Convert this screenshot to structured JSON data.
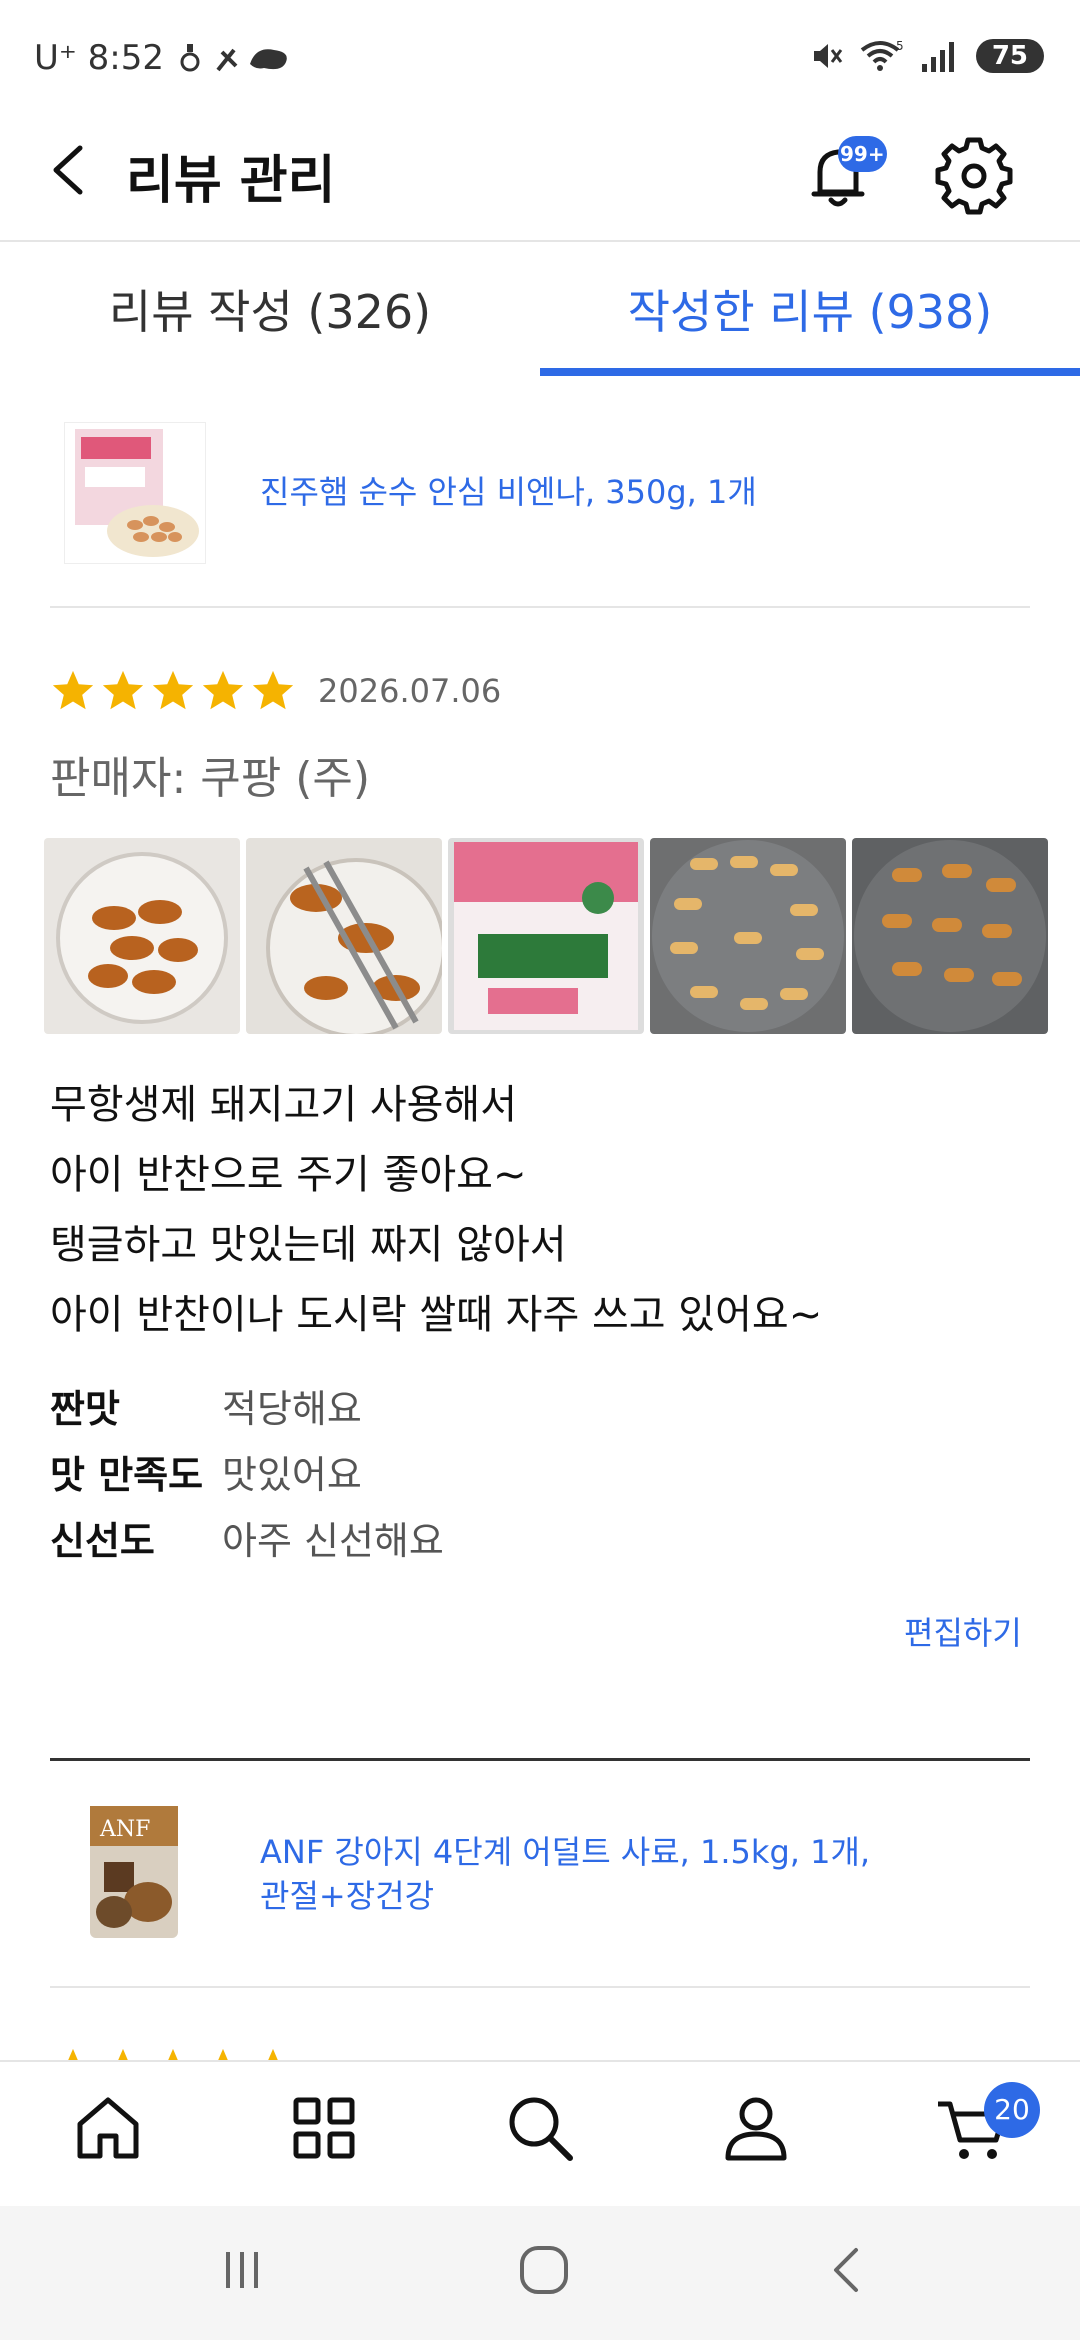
{
  "status_bar": {
    "carrier_time": "U⁺ 8:52",
    "battery": "75"
  },
  "header": {
    "title": "리뷰 관리",
    "notification_badge": "99+"
  },
  "tabs": [
    {
      "label": "리뷰 작성  (326)",
      "active": false
    },
    {
      "label": "작성한 리뷰 (938)",
      "active": true
    }
  ],
  "review": {
    "product_name": "진주햄 순수 안심 비엔나, 350g, 1개",
    "rating": 5,
    "date": "2026.07.06",
    "seller": "판매자: 쿠팡 (주)",
    "photo_count": 5,
    "text_lines": [
      "무항생제 돼지고기 사용해서",
      "아이 반찬으로 주기 좋아요~",
      "탱글하고 맛있는데 짜지 않아서",
      "아이 반찬이나 도시락 쌀때 자주 쓰고 있어요~"
    ],
    "ratings": [
      {
        "label": "짠맛",
        "value": "적당해요"
      },
      {
        "label": "맛 만족도",
        "value": "맛있어요"
      },
      {
        "label": "신선도",
        "value": "아주 신선해요"
      }
    ],
    "edit_label": "편집하기"
  },
  "next_product": {
    "name_line1": "ANF 강아지 4단계 어덜트 사료, 1.5kg, 1개,",
    "name_line2": "관절+장건강",
    "thumb_brand": "ANF"
  },
  "bottom_nav": {
    "items": [
      "home-icon",
      "category-icon",
      "search-icon",
      "account-icon",
      "cart-icon"
    ],
    "cart_count": "20"
  },
  "colors": {
    "accent": "#2e6ae6",
    "star": "#f5b301"
  }
}
